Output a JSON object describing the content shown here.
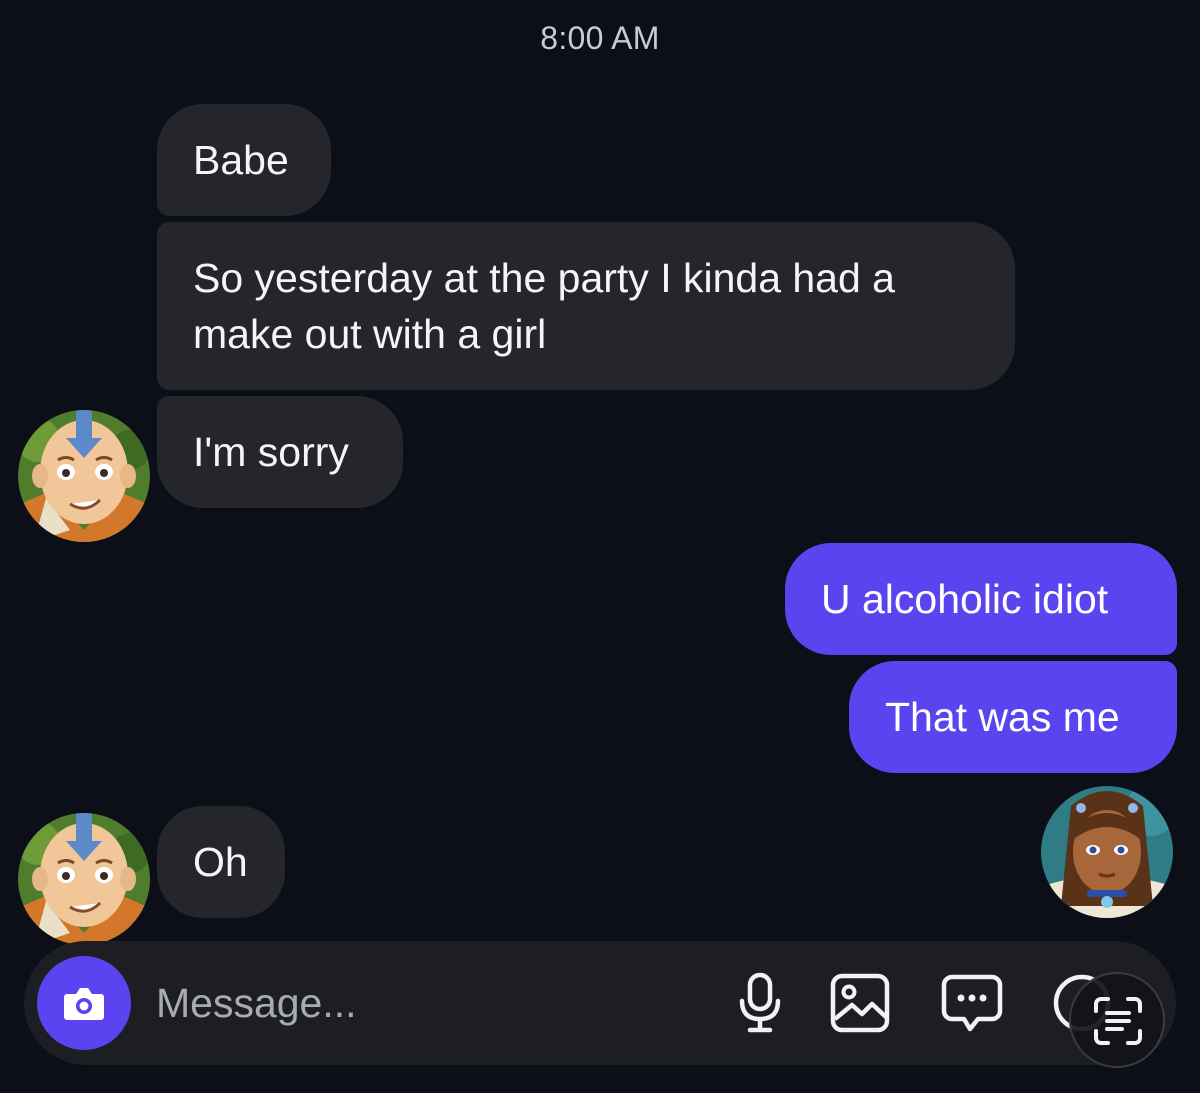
{
  "timestamp": "8:00 AM",
  "messages": [
    {
      "from": "them",
      "text": "Babe"
    },
    {
      "from": "them",
      "text": "So yesterday at the party I kinda had a make out with a girl"
    },
    {
      "from": "them",
      "text": "I'm sorry"
    },
    {
      "from": "me",
      "text": "U alcoholic idiot"
    },
    {
      "from": "me",
      "text": "That was me"
    },
    {
      "from": "them",
      "text": "Oh"
    }
  ],
  "composer": {
    "placeholder": "Message...",
    "icons": [
      "camera-icon",
      "microphone-icon",
      "gallery-icon",
      "sticker-icon",
      "more-icon",
      "scan-text-icon"
    ]
  },
  "colors": {
    "background": "#0c0f18",
    "received_bubble": "#25262c",
    "sent_bubble": "#5b43f0",
    "composer": "#1d1e24"
  }
}
